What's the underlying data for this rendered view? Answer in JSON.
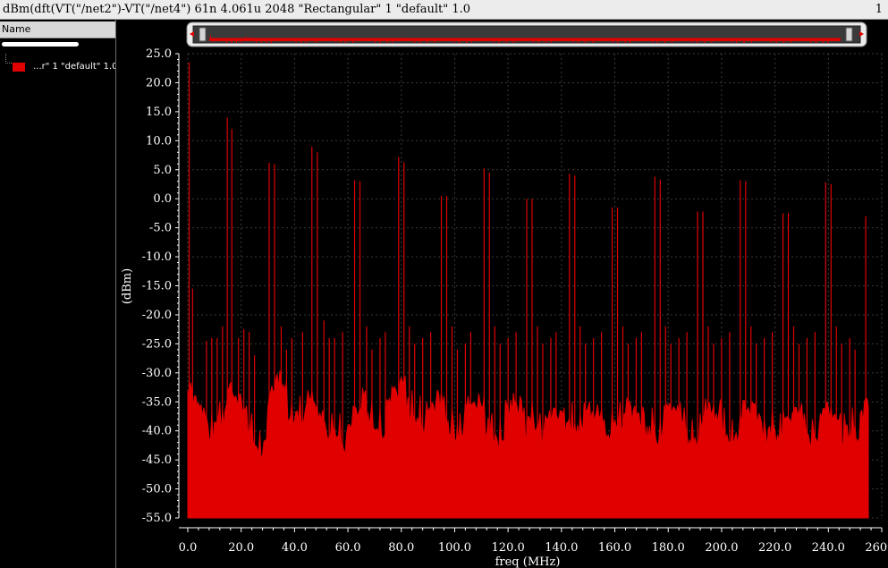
{
  "window": {
    "title": "dBm(dft(VT(\"/net2\")-VT(\"/net4\") 61n 4.061u 2048 \"Rectangular\" 1 \"default\" 1.0",
    "subwindow_number": "1"
  },
  "sidebar": {
    "header": "Name",
    "trace_label": "...r\" 1 \"default\" 1.0"
  },
  "colors": {
    "trace": "#e00000",
    "background": "#000000",
    "grid": "#3a3a3a",
    "axis": "#ffffff"
  },
  "chart_data": {
    "type": "area",
    "xlabel": "freq (MHz)",
    "ylabel": "(dBm)",
    "xlim": [
      0,
      260
    ],
    "ylim": [
      -55,
      25
    ],
    "x_ticks": [
      "0.0",
      "20.0",
      "40.0",
      "60.0",
      "80.0",
      "100.0",
      "120.0",
      "140.0",
      "160.0",
      "180.0",
      "200.0",
      "220.0",
      "240.0",
      "260.0"
    ],
    "y_ticks": [
      "25.0",
      "20.0",
      "15.0",
      "10.0",
      "5.0",
      "0.0",
      "-5.0",
      "-10.0",
      "-15.0",
      "-20.0",
      "-25.0",
      "-30.0",
      "-35.0",
      "-40.0",
      "-45.0",
      "-50.0",
      "-55.0"
    ],
    "grid": true,
    "series": [
      {
        "x_range": [
          0,
          255
        ],
        "floor": -55,
        "noise_floor": [
          [
            0,
            -33
          ],
          [
            3,
            -34
          ],
          [
            6,
            -36
          ],
          [
            9,
            -37
          ],
          [
            12,
            -35
          ],
          [
            15,
            -33
          ],
          [
            18,
            -34
          ],
          [
            21,
            -36
          ],
          [
            24,
            -37
          ],
          [
            27,
            -40
          ],
          [
            30,
            -36
          ],
          [
            33,
            -31
          ],
          [
            36,
            -32
          ],
          [
            39,
            -35
          ],
          [
            42,
            -34
          ],
          [
            45,
            -33
          ],
          [
            48,
            -36
          ],
          [
            51,
            -38
          ],
          [
            54,
            -37
          ],
          [
            57,
            -37
          ],
          [
            60,
            -39
          ],
          [
            63,
            -36
          ],
          [
            66,
            -34
          ],
          [
            69,
            -35
          ],
          [
            72,
            -36
          ],
          [
            75,
            -35
          ],
          [
            78,
            -33
          ],
          [
            81,
            -31
          ],
          [
            84,
            -33
          ],
          [
            87,
            -34
          ],
          [
            90,
            -37
          ],
          [
            93,
            -35
          ],
          [
            96,
            -34
          ],
          [
            99,
            -36
          ],
          [
            102,
            -37
          ],
          [
            105,
            -34
          ],
          [
            108,
            -36
          ],
          [
            111,
            -34
          ],
          [
            114,
            -37
          ],
          [
            117,
            -38
          ],
          [
            120,
            -36
          ],
          [
            123,
            -35
          ],
          [
            126,
            -36
          ],
          [
            129,
            -35
          ],
          [
            132,
            -37
          ],
          [
            135,
            -38
          ],
          [
            138,
            -37
          ],
          [
            141,
            -36
          ],
          [
            144,
            -35
          ],
          [
            147,
            -37
          ],
          [
            150,
            -36
          ],
          [
            153,
            -37
          ],
          [
            156,
            -38
          ],
          [
            159,
            -36
          ],
          [
            162,
            -35
          ],
          [
            165,
            -36
          ],
          [
            168,
            -38
          ],
          [
            171,
            -37
          ],
          [
            174,
            -36
          ],
          [
            177,
            -38
          ],
          [
            180,
            -36
          ],
          [
            183,
            -37
          ],
          [
            186,
            -36
          ],
          [
            189,
            -38
          ],
          [
            192,
            -37
          ],
          [
            195,
            -36
          ],
          [
            198,
            -37
          ],
          [
            201,
            -36
          ],
          [
            204,
            -38
          ],
          [
            207,
            -37
          ],
          [
            210,
            -36
          ],
          [
            213,
            -37
          ],
          [
            216,
            -38
          ],
          [
            219,
            -36
          ],
          [
            222,
            -37
          ],
          [
            225,
            -38
          ],
          [
            228,
            -36
          ],
          [
            231,
            -37
          ],
          [
            234,
            -38
          ],
          [
            237,
            -37
          ],
          [
            240,
            -36
          ],
          [
            243,
            -38
          ],
          [
            246,
            -37
          ],
          [
            249,
            -36
          ],
          [
            252,
            -37
          ],
          [
            255,
            -36
          ]
        ],
        "peaks": [
          [
            0.5,
            23.5
          ],
          [
            1.8,
            -15.5
          ],
          [
            7,
            -24.5
          ],
          [
            9,
            -24
          ],
          [
            11,
            -24
          ],
          [
            13,
            -22
          ],
          [
            14.8,
            14
          ],
          [
            16.5,
            12
          ],
          [
            19,
            -24
          ],
          [
            21,
            -22.5
          ],
          [
            23,
            -23
          ],
          [
            25,
            -27
          ],
          [
            30.5,
            6.2
          ],
          [
            32.5,
            6
          ],
          [
            35,
            -22
          ],
          [
            37,
            -26
          ],
          [
            39,
            -24
          ],
          [
            43,
            -23
          ],
          [
            46.5,
            9
          ],
          [
            48.5,
            8
          ],
          [
            51,
            -21
          ],
          [
            53,
            -24
          ],
          [
            55,
            -24
          ],
          [
            58,
            -23
          ],
          [
            62.5,
            3.2
          ],
          [
            64.5,
            3
          ],
          [
            67,
            -22
          ],
          [
            69,
            -26
          ],
          [
            72,
            -24
          ],
          [
            74,
            -23
          ],
          [
            79,
            7.2
          ],
          [
            81,
            6.3
          ],
          [
            83,
            -22
          ],
          [
            85,
            -25
          ],
          [
            88,
            -24
          ],
          [
            91,
            -23
          ],
          [
            95,
            0.5
          ],
          [
            97,
            0.5
          ],
          [
            99,
            -22
          ],
          [
            101,
            -26
          ],
          [
            104,
            -25
          ],
          [
            106,
            -23
          ],
          [
            111,
            5.2
          ],
          [
            113,
            4.5
          ],
          [
            115,
            -22
          ],
          [
            117,
            -25
          ],
          [
            120,
            -24
          ],
          [
            123,
            -23
          ],
          [
            127,
            0
          ],
          [
            129,
            0
          ],
          [
            131,
            -22
          ],
          [
            133,
            -25
          ],
          [
            136,
            -24
          ],
          [
            138,
            -23
          ],
          [
            143,
            4.3
          ],
          [
            145,
            4
          ],
          [
            147,
            -22
          ],
          [
            149,
            -25
          ],
          [
            152,
            -24
          ],
          [
            155,
            -23
          ],
          [
            159,
            -1.5
          ],
          [
            161,
            -1.5
          ],
          [
            163,
            -22
          ],
          [
            165,
            -25
          ],
          [
            168,
            -24
          ],
          [
            170,
            -23
          ],
          [
            175,
            3.8
          ],
          [
            177,
            3.3
          ],
          [
            179,
            -22
          ],
          [
            181,
            -25
          ],
          [
            184,
            -24
          ],
          [
            187,
            -23
          ],
          [
            191,
            -2.2
          ],
          [
            193,
            -2.2
          ],
          [
            195,
            -22
          ],
          [
            197,
            -25
          ],
          [
            200,
            -24
          ],
          [
            203,
            -23
          ],
          [
            207,
            3.2
          ],
          [
            209,
            3
          ],
          [
            211,
            -22
          ],
          [
            213,
            -25
          ],
          [
            216,
            -24
          ],
          [
            219,
            -23
          ],
          [
            223,
            -2.5
          ],
          [
            225,
            -2.5
          ],
          [
            227,
            -22
          ],
          [
            229,
            -25
          ],
          [
            232,
            -24
          ],
          [
            235,
            -23
          ],
          [
            239,
            2.8
          ],
          [
            241,
            2.5
          ],
          [
            243,
            -22
          ],
          [
            245,
            -25
          ],
          [
            248,
            -24
          ],
          [
            250,
            -26
          ],
          [
            254,
            -3
          ]
        ]
      }
    ]
  }
}
